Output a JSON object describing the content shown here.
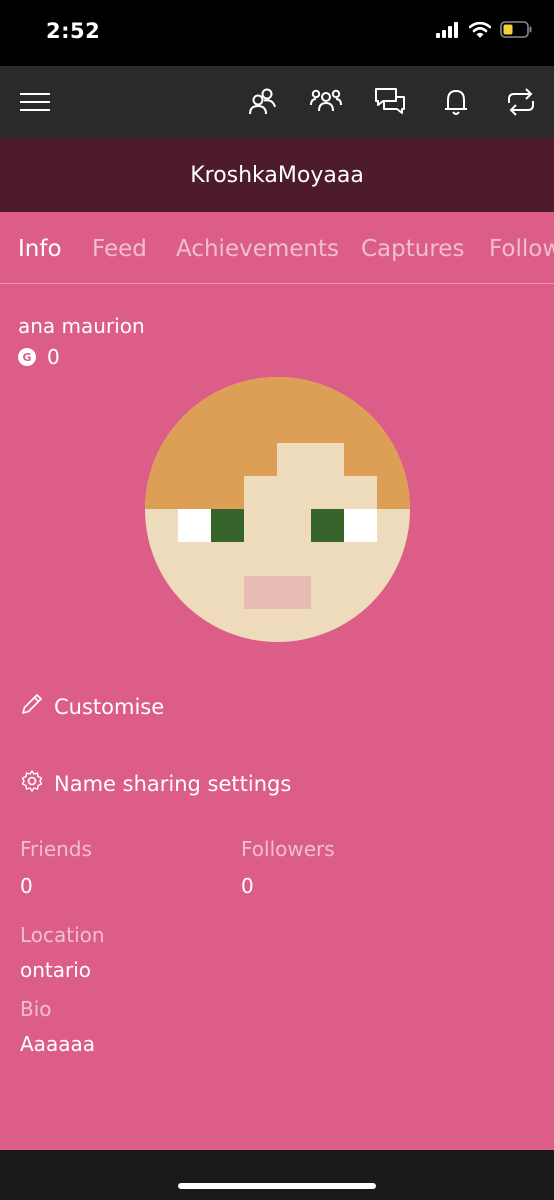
{
  "status_bar": {
    "time": "2:52"
  },
  "app_bar": {
    "icons": [
      "menu-icon",
      "friends-icon",
      "party-icon",
      "messages-icon",
      "notifications-icon",
      "sync-icon"
    ]
  },
  "profile": {
    "gamertag": "KroshkaMoyaaa",
    "real_name": "ana maurion",
    "gamerscore_badge": "G",
    "gamerscore": "0"
  },
  "tabs": [
    "Info",
    "Feed",
    "Achievements",
    "Captures",
    "Followers"
  ],
  "actions": {
    "customise": "Customise",
    "name_sharing": "Name sharing settings"
  },
  "stats": {
    "friends_label": "Friends",
    "friends_value": "0",
    "followers_label": "Followers",
    "followers_value": "0"
  },
  "details": {
    "location_label": "Location",
    "location_value": "ontario",
    "bio_label": "Bio",
    "bio_value": "Aaaaaa"
  },
  "colors": {
    "accent": "#dc5e88",
    "header": "#4e1a2d",
    "app_bar": "#2a2a2a",
    "avatar_hair": "#dd9e55",
    "avatar_skin": "#eedbbc",
    "avatar_eye": "#37642a",
    "avatar_mouth": "#e6bcb3"
  }
}
